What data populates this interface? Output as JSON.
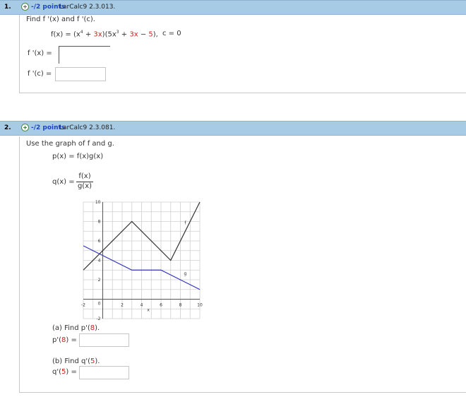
{
  "q1": {
    "number": "1.",
    "points": "-/2 points",
    "source": "LarCalc9 2.3.013.",
    "prompt": "Find f '(x) and f '(c).",
    "func_left": "f(x) = (x",
    "func_exp4": "4",
    "func_plus": "+",
    "func_3x": "3x",
    "func_mid": ")(5x",
    "func_exp3": "3",
    "func_plus2": "+",
    "func_3x2": "3x",
    "func_minus": "−",
    "func_5": "5",
    "func_end": "),",
    "c_value": "c = 0",
    "fpx_label": "f '(x) =",
    "fpc_label": "f '(c) ="
  },
  "q2": {
    "number": "2.",
    "points": "-/2 points",
    "source": "LarCalc9 2.3.081.",
    "prompt": "Use the graph of f and g.",
    "p_def": "p(x) = f(x)g(x)",
    "q_label": "q(x) =",
    "q_num": "f(x)",
    "q_den": "g(x)",
    "part_a_prompt_pre": "(a) Find p'(",
    "part_a_val": "8",
    "part_a_prompt_post": ").",
    "part_a_label_pre": "p'(",
    "part_a_label_post": ") =",
    "part_b_prompt_pre": "(b) Find q'(",
    "part_b_val": "5",
    "part_b_prompt_post": ").",
    "part_b_label_pre": "q'(",
    "part_b_label_post": ") ="
  },
  "chart_data": {
    "type": "line",
    "xlabel": "x",
    "ylabel": "",
    "xlim": [
      -2,
      10
    ],
    "ylim": [
      -2,
      10
    ],
    "x_ticks": [
      "-2",
      "2",
      "4",
      "6",
      "8",
      "10"
    ],
    "y_ticks": [
      "10",
      "8",
      "6",
      "4",
      "2",
      "-2"
    ],
    "origin_label": "0",
    "grid": true,
    "series": [
      {
        "name": "f",
        "color": "#333333",
        "points": [
          [
            -2,
            3
          ],
          [
            3,
            8
          ],
          [
            7,
            4
          ],
          [
            10,
            10
          ]
        ]
      },
      {
        "name": "g",
        "color": "#3333bb",
        "points": [
          [
            -2,
            5.5
          ],
          [
            3,
            3
          ],
          [
            6,
            3
          ],
          [
            10,
            1
          ]
        ]
      }
    ],
    "series_labels": [
      {
        "text": "f",
        "x": 8.5,
        "y": 7.7
      },
      {
        "text": "g",
        "x": 8.5,
        "y": 2.5
      }
    ]
  }
}
